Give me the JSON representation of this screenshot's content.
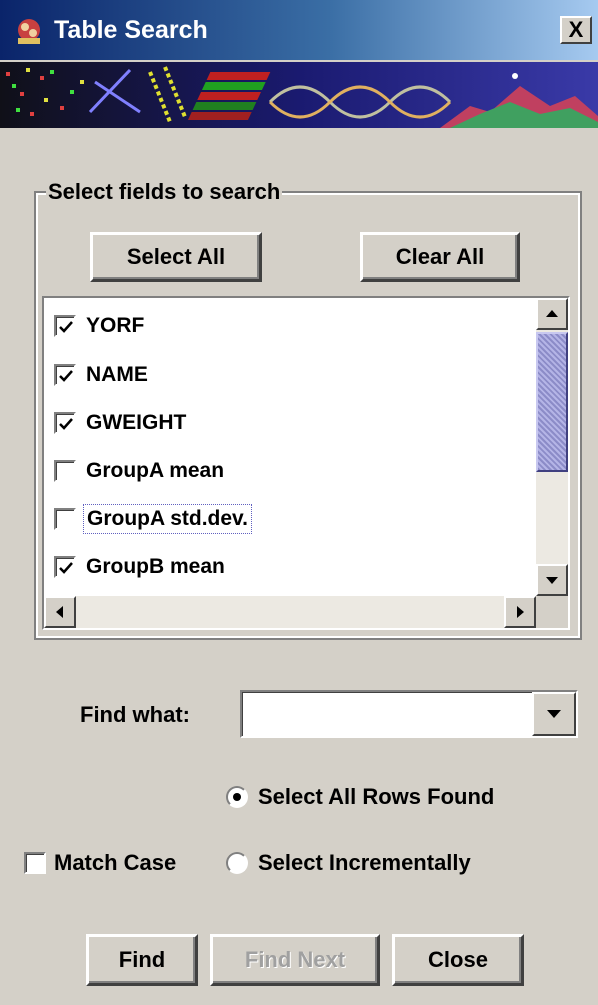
{
  "window": {
    "title": "Table Search",
    "close_label": "X"
  },
  "group": {
    "title": "Select fields to search",
    "select_all_label": "Select All",
    "clear_all_label": "Clear All"
  },
  "fields": [
    {
      "label": "YORF",
      "checked": true
    },
    {
      "label": "NAME",
      "checked": true
    },
    {
      "label": "GWEIGHT",
      "checked": true
    },
    {
      "label": "GroupA mean",
      "checked": false
    },
    {
      "label": "GroupA std.dev.",
      "checked": false
    },
    {
      "label": "GroupB mean",
      "checked": true
    }
  ],
  "find": {
    "label": "Find what:",
    "value": ""
  },
  "options": {
    "select_all_rows_label": "Select All Rows Found",
    "select_all_rows_selected": true,
    "match_case_label": "Match Case",
    "match_case_checked": false,
    "select_incrementally_label": "Select Incrementally",
    "select_incrementally_selected": false
  },
  "buttons": {
    "find": "Find",
    "find_next": "Find Next",
    "close": "Close"
  },
  "colors": {
    "titlebar_start": "#0a246a",
    "titlebar_end": "#a6caf0",
    "scroll_thumb": "#8c8cc8",
    "face": "#d4d0c8"
  }
}
